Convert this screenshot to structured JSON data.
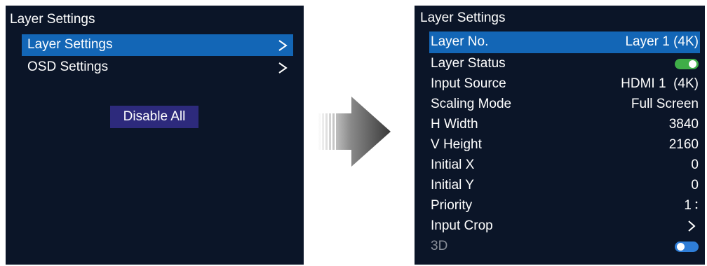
{
  "colors": {
    "screen_bg": "#0b1528",
    "selected_bg": "#1366b6",
    "button_bg": "#2d2a7c",
    "toggle_on": "#3fae48",
    "toggle_off": "#2f7ed8",
    "text": "#ffffff",
    "disabled_text": "#8a8f99"
  },
  "left_panel": {
    "title": "Layer Settings",
    "items": [
      {
        "label": "Layer Settings",
        "selected": true,
        "icon": "chevron-right-icon"
      },
      {
        "label": "OSD Settings",
        "selected": false,
        "icon": "chevron-right-icon"
      }
    ],
    "disable_all_label": "Disable All"
  },
  "transition": {
    "icon": "arrow-right-icon"
  },
  "right_panel": {
    "title": "Layer Settings",
    "rows": [
      {
        "label": "Layer No.",
        "value": "Layer 1 (4K)",
        "selected": true
      },
      {
        "label": "Layer Status",
        "toggle": "on"
      },
      {
        "label": "Input Source",
        "value": "HDMI 1  (4K)"
      },
      {
        "label": "Scaling Mode",
        "value": "Full Screen"
      },
      {
        "label": "H Width",
        "value": "3840"
      },
      {
        "label": "V Height",
        "value": "2160"
      },
      {
        "label": "Initial X",
        "value": "0"
      },
      {
        "label": "Initial Y",
        "value": "0"
      },
      {
        "label": "Priority",
        "value": "1",
        "icon": "spinner-icon"
      },
      {
        "label": "Input Crop",
        "icon": "chevron-right-icon"
      },
      {
        "label": "3D",
        "toggle": "off",
        "disabled": true
      }
    ]
  }
}
